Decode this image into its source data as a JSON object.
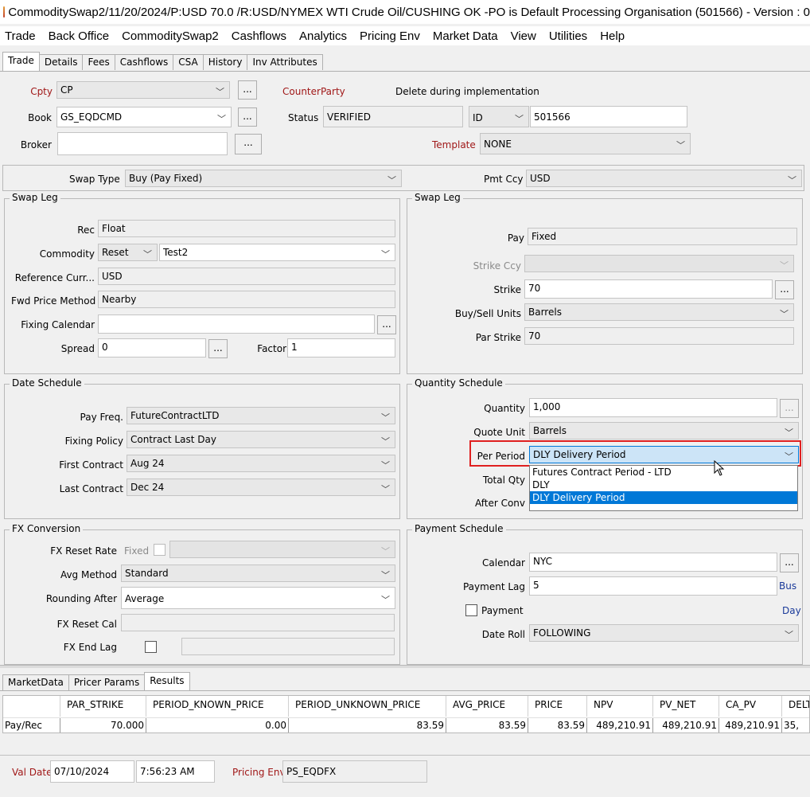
{
  "window": {
    "title": "CommoditySwap2/11/20/2024/P:USD 70.0 /R:USD/NYMEX WTI Crude Oil/CUSHING OK  -PO is Default Processing Organisation  (501566) - Version : 0"
  },
  "menu": [
    "Trade",
    "Back Office",
    "CommoditySwap2",
    "Cashflows",
    "Analytics",
    "Pricing Env",
    "Market Data",
    "View",
    "Utilities",
    "Help"
  ],
  "tabs": [
    "Trade",
    "Details",
    "Fees",
    "Cashflows",
    "CSA",
    "History",
    "Inv Attributes"
  ],
  "header": {
    "cpty_label": "Cpty",
    "cpty_value": "CP",
    "counterparty_label": "CounterParty",
    "delete_note": "Delete during implementation",
    "book_label": "Book",
    "book_value": "GS_EQDCMD",
    "status_label": "Status",
    "status_value": "VERIFIED",
    "id_type": "ID",
    "id_value": "501566",
    "broker_label": "Broker",
    "broker_value": "",
    "template_label": "Template",
    "template_value": "NONE",
    "dots": "..."
  },
  "swap": {
    "swap_type_label": "Swap Type",
    "swap_type_value": "Buy (Pay Fixed)",
    "pmt_ccy_label": "Pmt Ccy",
    "pmt_ccy_value": "USD"
  },
  "left_leg": {
    "title": "Swap Leg",
    "rec_label": "Rec",
    "rec_value": "Float",
    "commodity_label": "Commodity",
    "commodity_reset": "Reset",
    "commodity_value": "Test2",
    "ref_curr_label": "Reference Curr...",
    "ref_curr_value": "USD",
    "fwd_label": "Fwd Price Method",
    "fwd_value": "Nearby",
    "fixing_cal_label": "Fixing Calendar",
    "fixing_cal_value": "",
    "spread_label": "Spread",
    "spread_value": "0",
    "factor_label": "Factor",
    "factor_value": "1"
  },
  "right_leg": {
    "title": "Swap Leg",
    "pay_label": "Pay",
    "pay_value": "Fixed",
    "strike_ccy_label": "Strike Ccy",
    "strike_ccy_value": "",
    "strike_label": "Strike",
    "strike_value": "70",
    "units_label": "Buy/Sell Units",
    "units_value": "Barrels",
    "par_strike_label": "Par Strike",
    "par_strike_value": "70"
  },
  "date_schedule": {
    "title": "Date Schedule",
    "pay_freq_label": "Pay Freq.",
    "pay_freq_value": "FutureContractLTD",
    "fixing_policy_label": "Fixing Policy",
    "fixing_policy_value": "Contract Last Day",
    "first_contract_label": "First Contract",
    "first_contract_value": "Aug 24",
    "last_contract_label": "Last Contract",
    "last_contract_value": "Dec 24"
  },
  "quantity_schedule": {
    "title": "Quantity Schedule",
    "quantity_label": "Quantity",
    "quantity_value": "1,000",
    "quote_unit_label": "Quote Unit",
    "quote_unit_value": "Barrels",
    "per_period_label": "Per Period",
    "per_period_value": "DLY Delivery Period",
    "total_qty_label": "Total Qty",
    "after_conv_label": "After Conv",
    "dropdown_options": [
      "Futures Contract Period - LTD",
      "DLY",
      "DLY Delivery Period"
    ]
  },
  "fx": {
    "title": "FX Conversion",
    "reset_rate_label": "FX Reset Rate",
    "fixed_label": "Fixed",
    "avg_method_label": "Avg Method",
    "avg_method_value": "Standard",
    "rounding_label": "Rounding After",
    "rounding_value": "Average",
    "reset_cal_label": "FX Reset Cal",
    "end_lag_label": "FX End Lag"
  },
  "payment_schedule": {
    "title": "Payment Schedule",
    "calendar_label": "Calendar",
    "calendar_value": "NYC",
    "lag_label": "Payment Lag",
    "lag_value": "5",
    "bus_label": "Bus",
    "payment_label": "Payment",
    "day_label": "Day",
    "date_roll_label": "Date Roll",
    "date_roll_value": "FOLLOWING"
  },
  "bottom_tabs": [
    "MarketData",
    "Pricer Params",
    "Results"
  ],
  "results": {
    "columns": [
      "PAR_STRIKE",
      "PERIOD_KNOWN_PRICE",
      "PERIOD_UNKNOWN_PRICE",
      "AVG_PRICE",
      "PRICE",
      "NPV",
      "PV_NET",
      "CA_PV",
      "DELT"
    ],
    "row_label": "Pay/Rec",
    "values": [
      "70.000",
      "0.00",
      "83.59",
      "83.59",
      "83.59",
      "489,210.91",
      "489,210.91",
      "489,210.91",
      "35,"
    ]
  },
  "footer": {
    "val_date_label": "Val Date",
    "val_date_value": "07/10/2024",
    "time_value": "7:56:23 AM",
    "pricing_env_label": "Pricing Env",
    "pricing_env_value": "PS_EQDFX"
  },
  "colors": {
    "accent_red": "#a01818",
    "selection_blue": "#0078d7",
    "highlight_box": "#e02020"
  }
}
